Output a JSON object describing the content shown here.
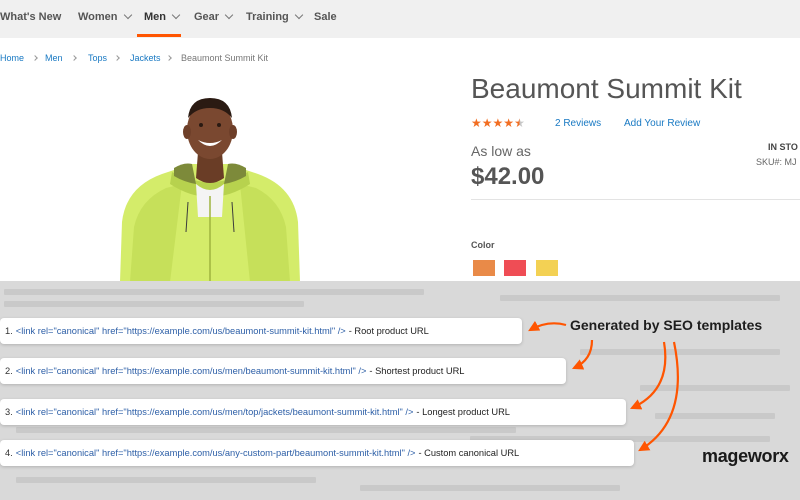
{
  "nav": {
    "items": [
      {
        "label": "What's New",
        "chevron": false
      },
      {
        "label": "Women",
        "chevron": true
      },
      {
        "label": "Men",
        "chevron": true,
        "active": true
      },
      {
        "label": "Gear",
        "chevron": true
      },
      {
        "label": "Training",
        "chevron": true
      },
      {
        "label": "Sale",
        "chevron": false
      }
    ]
  },
  "breadcrumb": [
    "Home",
    "Men",
    "Tops",
    "Jackets",
    "Beaumont Summit Kit"
  ],
  "product": {
    "title": "Beaumont Summit Kit",
    "rating_stars": 4.5,
    "reviews_link": "2  Reviews",
    "add_review": "Add Your Review",
    "as_low_as": "As low as",
    "price": "$42.00",
    "stock": "IN STO",
    "sku": "SKU#:  MJ",
    "color_label": "Color",
    "swatches": [
      "#e98a48",
      "#ef4d55",
      "#f3d154"
    ]
  },
  "canonical": [
    {
      "num": "1.",
      "tag": "<link  rel=\"canonical\"  href=\"https://example.com/us/beaumont-summit-kit.html\"  />",
      "desc": "- Root product URL"
    },
    {
      "num": "2.",
      "tag": "<link  rel=\"canonical\"  href=\"https://example.com/us/men/beaumont-summit-kit.html\"  />",
      "desc": "- Shortest product URL"
    },
    {
      "num": "3.",
      "tag": "<link  rel=\"canonical\"  href=\"https://example.com/us/men/top/jackets/beaumont-summit-kit.html\"  />",
      "desc": "- Longest product URL"
    },
    {
      "num": "4.",
      "tag": "<link  rel=\"canonical\"  href=\"https://example.com/us/any-custom-part/beaumont-summit-kit.html\"  />",
      "desc": "- Custom canonical URL"
    }
  ],
  "annotation": "Generated by SEO templates",
  "brand": "mageworx",
  "colors": {
    "accent": "#ff5501",
    "link": "#1979c3",
    "code": "#2d5fa7"
  }
}
